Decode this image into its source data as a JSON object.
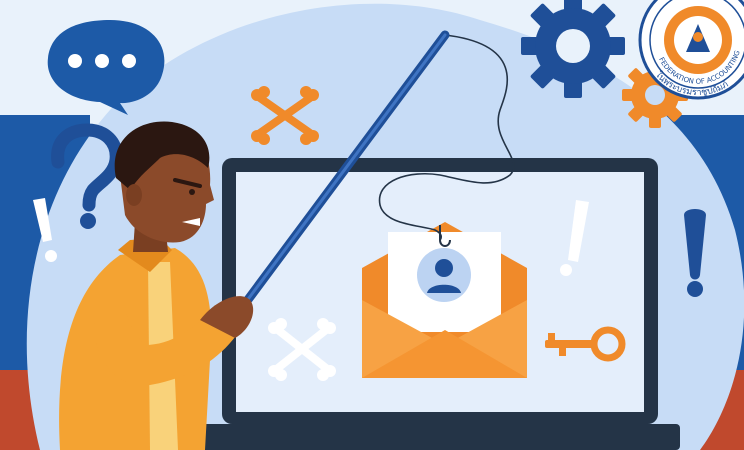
{
  "scene": {
    "description_colors": {
      "sky": "#e9f2fb",
      "blob": "#c7dcf6",
      "wall_blue": "#1d5aa7",
      "wall_red": "#c0492d",
      "accent_orange": "#f08a2a",
      "navy": "#1f4f98",
      "skin": "#8b4a2a",
      "shirt": "#f4a332"
    },
    "icons": [
      "speech-bubble-icon",
      "question-mark-icon",
      "exclamation-icon",
      "gear-icon",
      "crossbones-icon",
      "envelope-icon",
      "user-avatar-icon",
      "key-icon",
      "fishing-hook-icon",
      "fishing-rod-icon"
    ]
  },
  "seal": {
    "text_lines": [
      "FEDERATION OF ACCOUNTING PROFESSIONS",
      "ในพระบรมราชูปถัมภ์"
    ]
  }
}
